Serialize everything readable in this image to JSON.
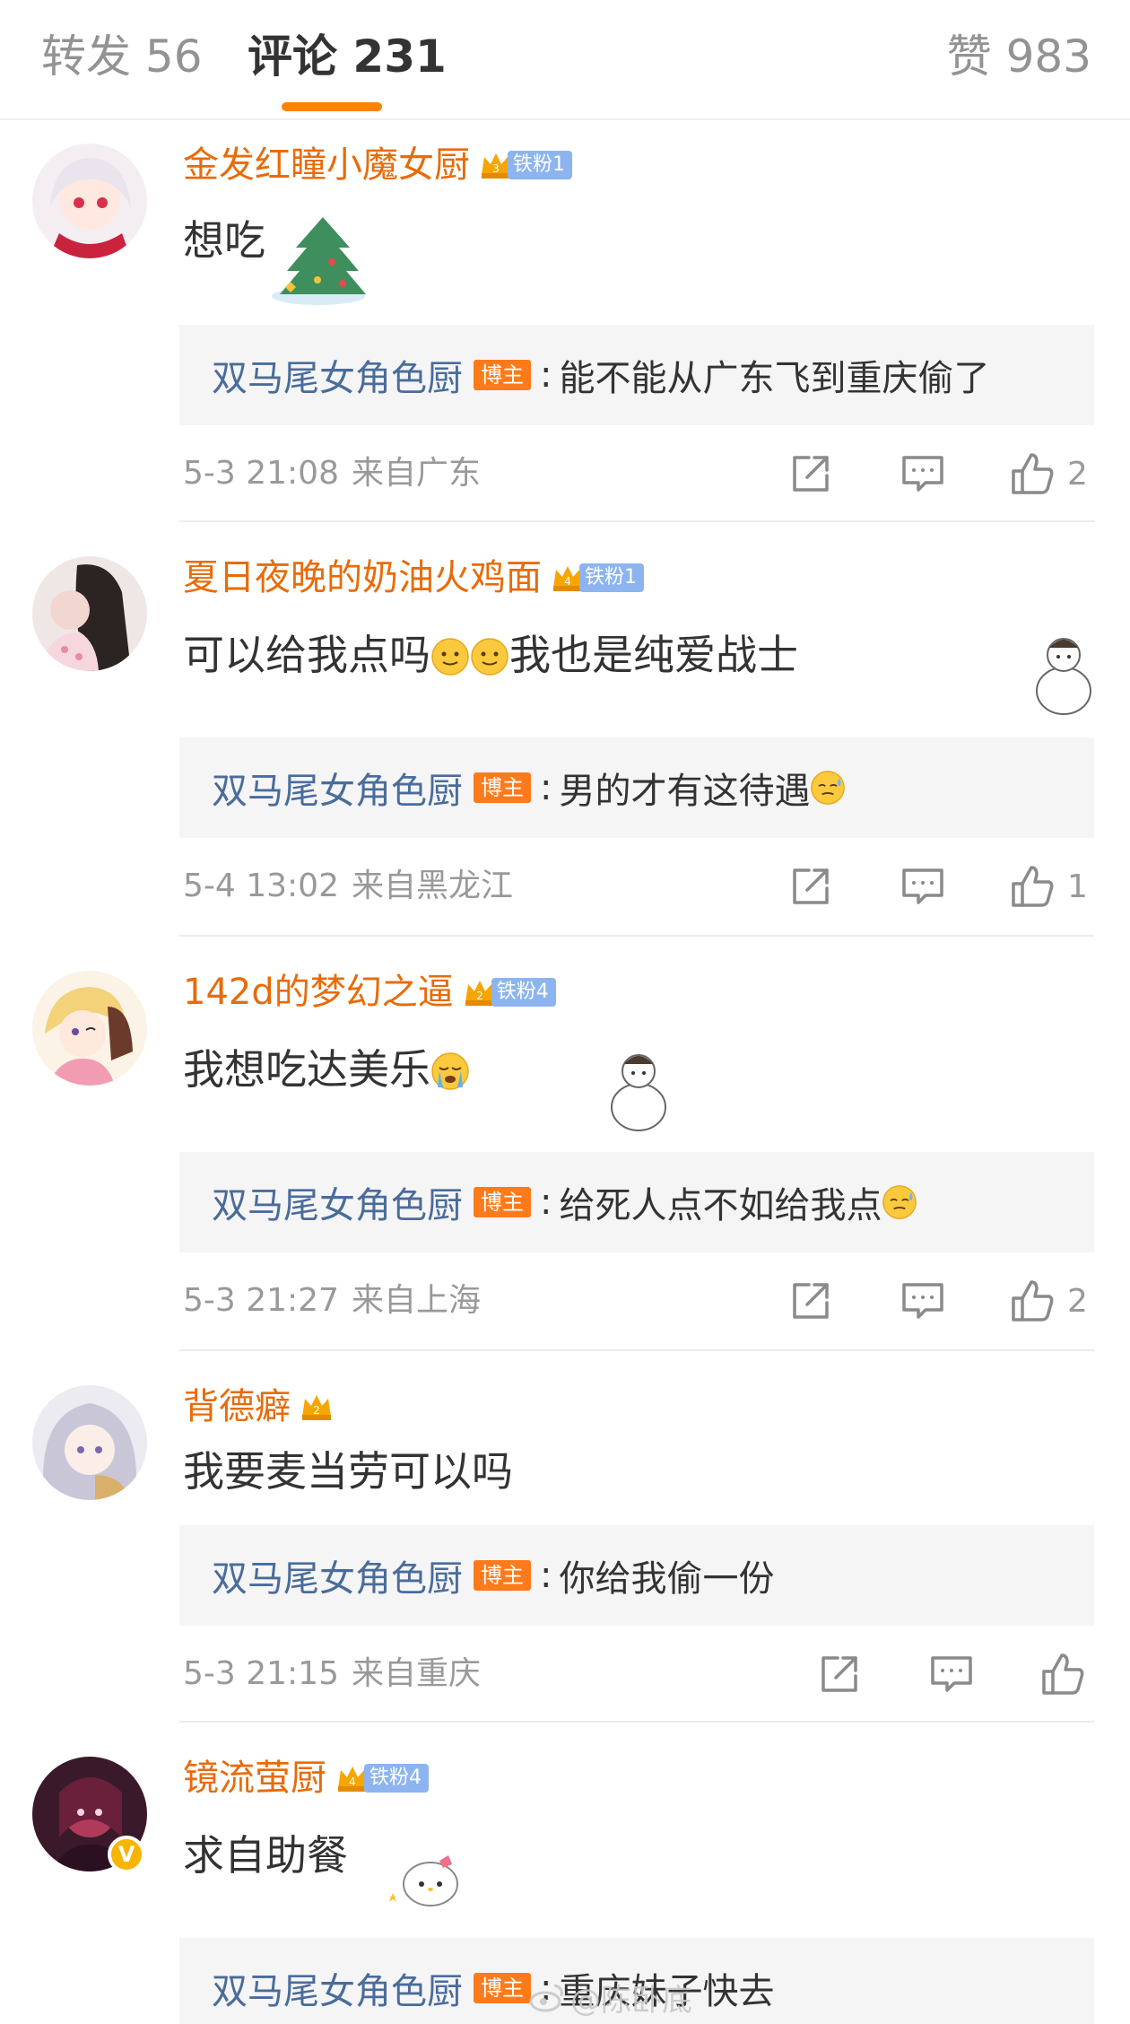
{
  "tabs": {
    "repost": "转发 56",
    "comments": "评论 231",
    "likes": "赞 983"
  },
  "colors": {
    "accent": "#ff8200",
    "username": "#e86b0a",
    "reply_name": "#4a6c9b",
    "blogger_badge": "#ff7a1a",
    "fan_badge": "#8cb4f0"
  },
  "comments": [
    {
      "username": "金发红瞳小魔女厨",
      "fan_badge": "铁粉1",
      "crown_level": "3",
      "text": "想吃",
      "reply": {
        "name": "双马尾女角色厨",
        "badge": "博主",
        "text": "能不能从广东飞到重庆偷了"
      },
      "time": "5-3 21:08",
      "location": "来自广东",
      "like_count": "2"
    },
    {
      "username": "夏日夜晚的奶油火鸡面",
      "fan_badge": "铁粉1",
      "crown_level": "4",
      "text_before": "可以给我点吗",
      "text_after": "我也是纯爱战士",
      "reply": {
        "name": "双马尾女角色厨",
        "badge": "博主",
        "text": "男的才有这待遇"
      },
      "time": "5-4 13:02",
      "location": "来自黑龙江",
      "like_count": "1"
    },
    {
      "username": "142d的梦幻之逼",
      "fan_badge": "铁粉4",
      "crown_level": "2",
      "text": "我想吃达美乐",
      "reply": {
        "name": "双马尾女角色厨",
        "badge": "博主",
        "text": "给死人点不如给我点"
      },
      "time": "5-3 21:27",
      "location": "来自上海",
      "like_count": "2"
    },
    {
      "username": "背德癖",
      "crown_level": "2",
      "text": "我要麦当劳可以吗",
      "reply": {
        "name": "双马尾女角色厨",
        "badge": "博主",
        "text": "你给我偷一份"
      },
      "time": "5-3 21:15",
      "location": "来自重庆",
      "like_count": ""
    },
    {
      "username": "镜流萤厨",
      "fan_badge": "铁粉4",
      "crown_level": "4",
      "text": "求自助餐",
      "reply": {
        "name": "双马尾女角色厨",
        "badge": "博主",
        "text": "重庆妹子快去"
      }
    }
  ],
  "watermark": "@陈卧底"
}
